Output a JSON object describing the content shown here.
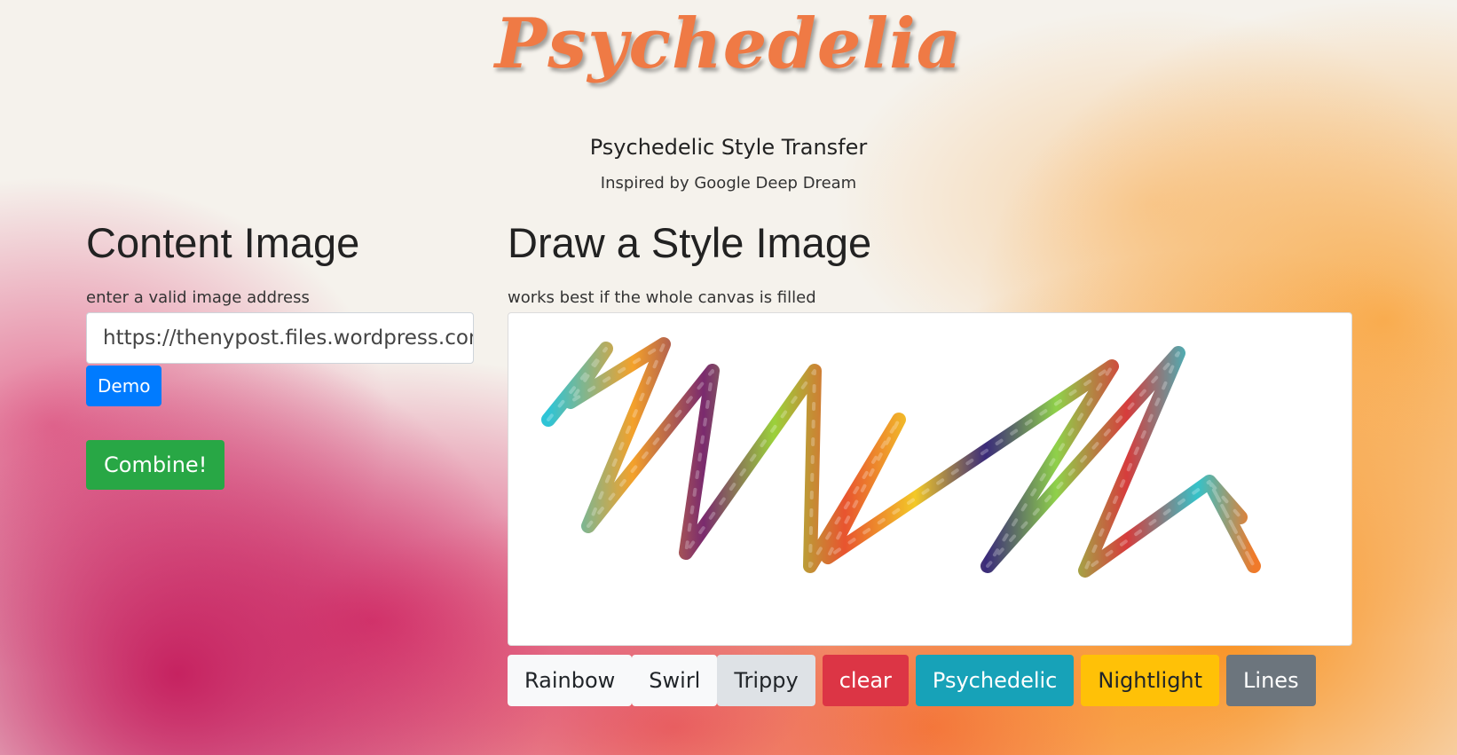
{
  "header": {
    "logo": "Psychedelia",
    "subtitle": "Psychedelic Style Transfer",
    "tagline": "Inspired by Google Deep Dream"
  },
  "content": {
    "heading": "Content Image",
    "hint": "enter a valid image address",
    "url_value": "https://thenypost.files.wordpress.com",
    "demo_label": "Demo",
    "combine_label": "Combine!"
  },
  "style": {
    "heading": "Draw a Style Image",
    "hint": "works best if the whole canvas is filled",
    "brushes": [
      {
        "label": "Rainbow"
      },
      {
        "label": "Swirl"
      },
      {
        "label": "Trippy"
      }
    ],
    "clear_label": "clear",
    "psychedelic_label": "Psychedelic",
    "nightlight_label": "Nightlight",
    "lines_label": "Lines"
  },
  "colors": {
    "logo": "#ef7a45",
    "demo": "#007bff",
    "combine": "#28a745",
    "clear": "#dc3545",
    "psychedelic": "#17a2b8",
    "nightlight": "#ffc107",
    "lines": "#6c757d"
  }
}
